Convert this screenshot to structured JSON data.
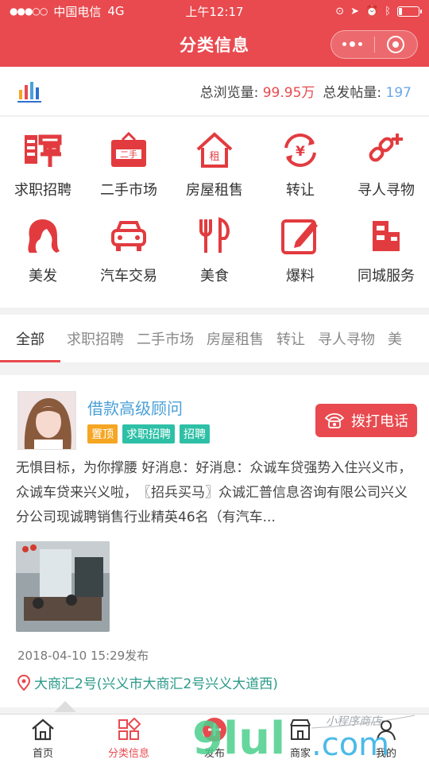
{
  "status": {
    "carrier": "中国电信",
    "network": "4G",
    "time": "上午12:17",
    "battery_level": 0.15
  },
  "navbar": {
    "title": "分类信息"
  },
  "stats": {
    "views_label": "总浏览量:",
    "views_value": "99.95万",
    "posts_label": "总发帖量:",
    "posts_value": "197"
  },
  "categories": [
    {
      "label": "求职招聘",
      "icon": "recruit-icon"
    },
    {
      "label": "二手市场",
      "icon": "second-hand-icon"
    },
    {
      "label": "房屋租售",
      "icon": "house-rent-icon"
    },
    {
      "label": "转让",
      "icon": "transfer-icon"
    },
    {
      "label": "寻人寻物",
      "icon": "lost-found-icon"
    },
    {
      "label": "美发",
      "icon": "hair-icon"
    },
    {
      "label": "汽车交易",
      "icon": "car-icon"
    },
    {
      "label": "美食",
      "icon": "food-icon"
    },
    {
      "label": "爆料",
      "icon": "report-icon"
    },
    {
      "label": "同城服务",
      "icon": "city-service-icon"
    }
  ],
  "tabs": [
    "全部",
    "求职招聘",
    "二手市场",
    "房屋租售",
    "转让",
    "寻人寻物",
    "美"
  ],
  "post": {
    "title": "借款高级顾问",
    "tags": [
      "置顶",
      "求职招聘",
      "招聘"
    ],
    "call_label": "拨打电话",
    "description": "无惧目标，为你撑腰 好消息：好消息：众诚车贷强势入住兴义市，众诚车贷来兴义啦，　〖招兵买马〗众诚汇普信息咨询有限公司兴义分公司现诚聘销售行业精英46名（有汽车...",
    "time": "2018-04-10 15:29发布",
    "location": "大商汇2号(兴义市大商汇2号兴义大道西)"
  },
  "tabbar": [
    {
      "label": "首页",
      "icon": "home-icon"
    },
    {
      "label": "分类信息",
      "icon": "category-icon"
    },
    {
      "label": "发布",
      "icon": "publish-icon"
    },
    {
      "label": "商家",
      "icon": "shop-icon"
    },
    {
      "label": "我的",
      "icon": "user-icon"
    }
  ],
  "watermark": {
    "text": "小程序商店",
    "domain": ".com",
    "brand": "9lul"
  },
  "colors": {
    "brand_red": "#e84a4f",
    "link_blue": "#4aa0d8",
    "teal": "#2ec0a6",
    "orange": "#f5a623"
  }
}
